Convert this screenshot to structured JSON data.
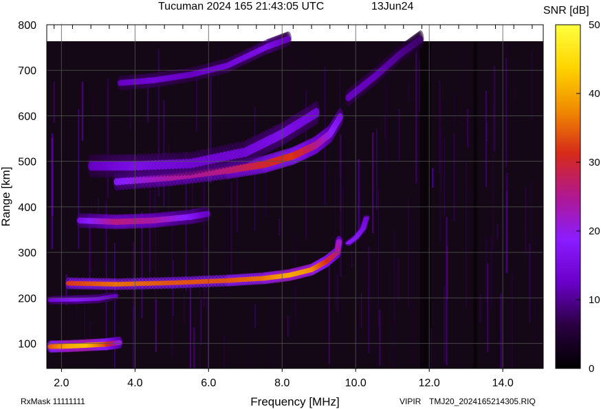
{
  "header": {
    "title": "Tucuman 2024 165 21:43:05 UTC",
    "date": "13Jun24"
  },
  "footer": {
    "rxmask": "RxMask 11111111",
    "system": "VIPIR",
    "filename": "TMJ20_2024165214305.RIQ"
  },
  "colorbar": {
    "label": "SNR [dB]",
    "ticks": [
      0,
      10,
      20,
      30,
      40,
      50
    ],
    "min": 0,
    "max": 50,
    "colormap": [
      "#000000",
      "#2a0040",
      "#6a00c8",
      "#8a1cff",
      "#b01890",
      "#d62a1a",
      "#f08a00",
      "#ffd400",
      "#ffff40"
    ]
  },
  "colors": {
    "background": "#ffffff",
    "plot_background": "#140716",
    "grid": "#555555"
  },
  "chart_data": {
    "type": "heatmap",
    "title": "Tucuman 2024 165 21:43:05 UTC",
    "xlabel": "Frequency [MHz]",
    "ylabel": "Range [km]",
    "xlim": [
      1.6,
      15.1
    ],
    "ylim": [
      45,
      800
    ],
    "x_ticks": [
      "2.0",
      "4.0",
      "6.0",
      "8.0",
      "10.0",
      "12.0",
      "14.0"
    ],
    "y_ticks": [
      "100",
      "200",
      "300",
      "400",
      "500",
      "600",
      "700",
      "800"
    ],
    "grid": true,
    "colorbar_label": "SNR [dB]",
    "traces": [
      {
        "points": [
          [
            1.7,
            93,
            34
          ],
          [
            2.2,
            94,
            40
          ],
          [
            2.7,
            96,
            42
          ],
          [
            3.2,
            98,
            34
          ],
          [
            3.6,
            102,
            20
          ]
        ],
        "width": 8
      },
      {
        "points": [
          [
            1.7,
            195,
            14
          ],
          [
            2.4,
            196,
            18
          ],
          [
            3.0,
            198,
            16
          ],
          [
            3.5,
            205,
            12
          ]
        ],
        "width": 6
      },
      {
        "points": [
          [
            2.2,
            232,
            32
          ],
          [
            3.5,
            230,
            36
          ],
          [
            5.0,
            233,
            34
          ],
          [
            6.5,
            238,
            34
          ],
          [
            7.5,
            243,
            36
          ],
          [
            8.2,
            250,
            40
          ],
          [
            8.8,
            262,
            38
          ],
          [
            9.2,
            280,
            32
          ],
          [
            9.5,
            300,
            26
          ],
          [
            9.55,
            325,
            22
          ]
        ],
        "width": 8
      },
      {
        "points": [
          [
            9.8,
            320,
            18
          ],
          [
            10.0,
            332,
            18
          ],
          [
            10.2,
            352,
            16
          ],
          [
            10.3,
            378,
            14
          ]
        ],
        "width": 4
      },
      {
        "points": [
          [
            2.5,
            370,
            16
          ],
          [
            3.5,
            367,
            26
          ],
          [
            4.5,
            370,
            24
          ],
          [
            5.5,
            378,
            18
          ],
          [
            6.0,
            385,
            12
          ]
        ],
        "width": 10
      },
      {
        "points": [
          [
            3.5,
            455,
            18
          ],
          [
            5.0,
            465,
            24
          ],
          [
            6.5,
            480,
            26
          ],
          [
            7.5,
            493,
            30
          ],
          [
            8.3,
            512,
            32
          ],
          [
            8.9,
            535,
            26
          ],
          [
            9.3,
            560,
            20
          ],
          [
            9.6,
            600,
            16
          ]
        ],
        "width": 12
      },
      {
        "points": [
          [
            2.8,
            490,
            12
          ],
          [
            4.0,
            490,
            16
          ],
          [
            5.5,
            495,
            14
          ],
          [
            7.0,
            520,
            14
          ],
          [
            8.0,
            560,
            16
          ],
          [
            9.0,
            610,
            14
          ]
        ],
        "width": 16
      },
      {
        "points": [
          [
            3.6,
            672,
            12
          ],
          [
            4.5,
            678,
            14
          ],
          [
            5.5,
            690,
            12
          ],
          [
            6.5,
            710,
            14
          ],
          [
            7.6,
            752,
            16
          ],
          [
            8.2,
            770,
            12
          ]
        ],
        "width": 10
      },
      {
        "points": [
          [
            9.8,
            640,
            12
          ],
          [
            10.5,
            685,
            12
          ],
          [
            11.2,
            735,
            10
          ],
          [
            11.8,
            770,
            8
          ]
        ],
        "width": 12
      }
    ]
  }
}
